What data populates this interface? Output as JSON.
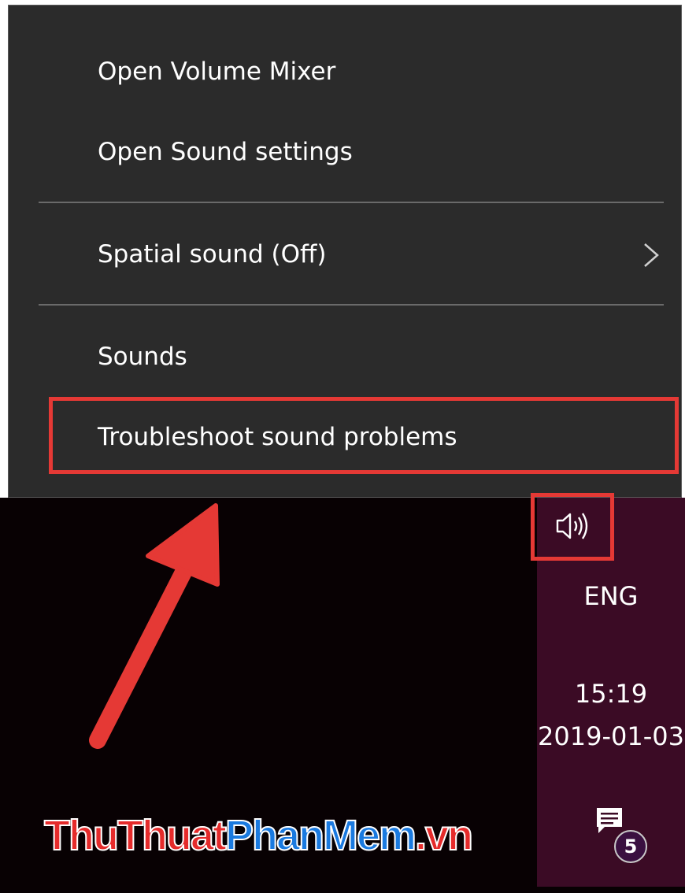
{
  "context_menu": {
    "items": [
      {
        "label": "Open Volume Mixer"
      },
      {
        "label": "Open Sound settings"
      },
      {
        "label": "Spatial sound (Off)",
        "submenu": true
      },
      {
        "label": "Sounds"
      },
      {
        "label": "Troubleshoot sound problems",
        "highlighted": true
      }
    ]
  },
  "taskbar": {
    "volume_icon": "speaker-volume-icon",
    "language": "ENG",
    "time": "15:19",
    "date": "2019-01-03",
    "notification_icon": "action-center-icon",
    "notification_count": "5"
  },
  "annotation": {
    "highlight_color": "#e53935",
    "arrow_color": "#e53935"
  },
  "watermark": {
    "part1": "ThuThuat",
    "part2": "PhanMem",
    "part3": ".vn"
  },
  "colors": {
    "menu_bg": "#2b2b2b",
    "taskbar_bg": "#3b0b25",
    "desktop_bg": "#080103"
  }
}
